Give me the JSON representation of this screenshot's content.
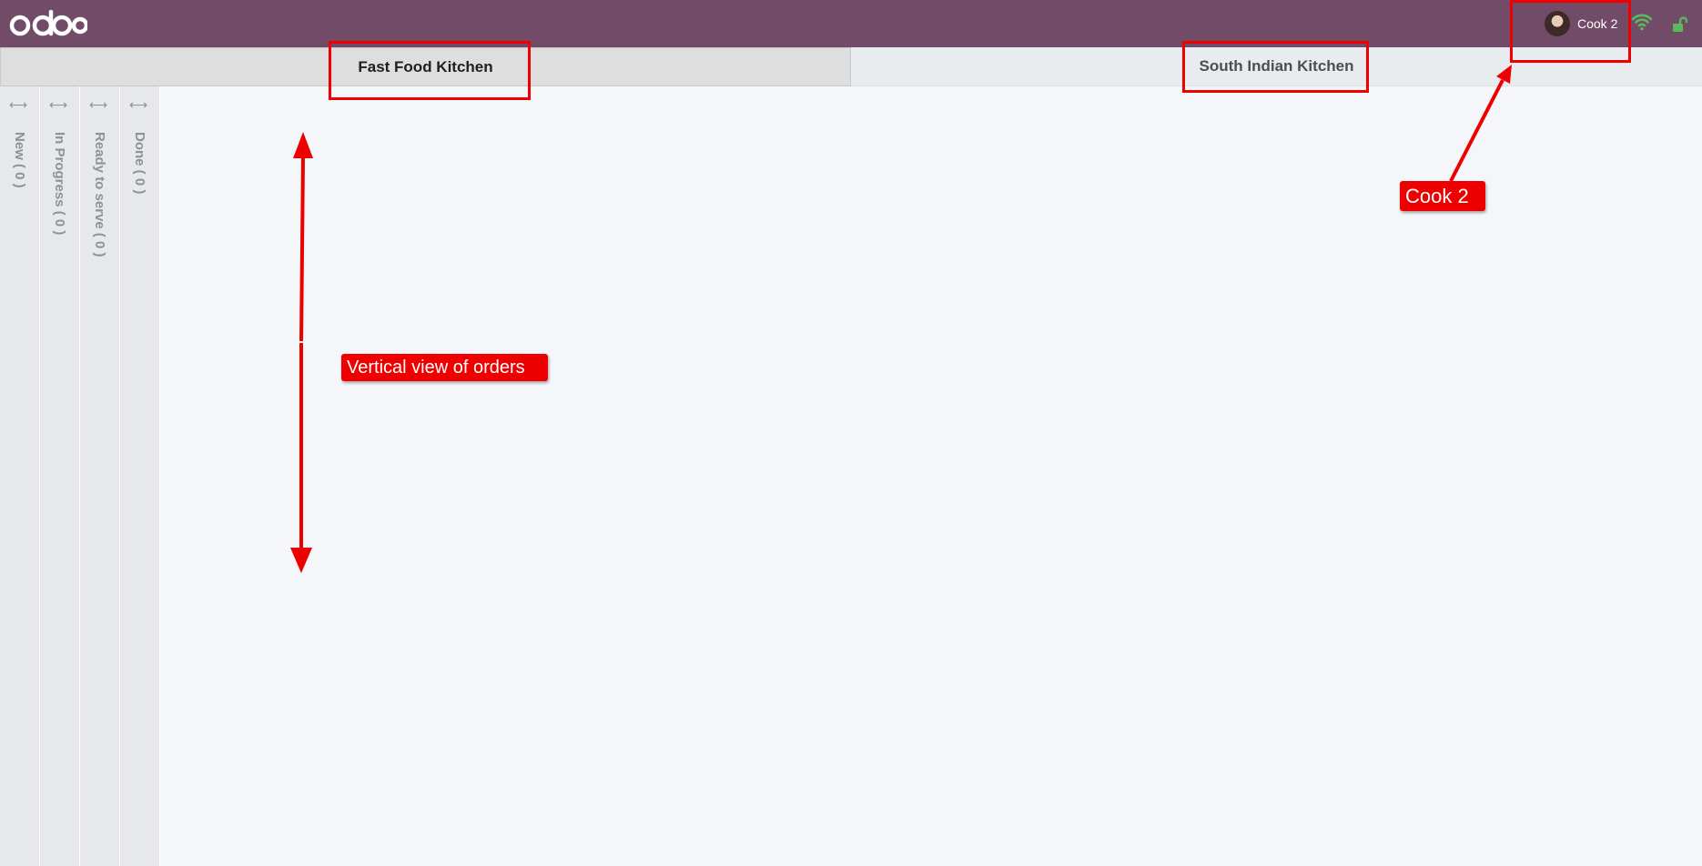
{
  "navbar": {
    "logo_text": "odoo",
    "user_name": "Cook 2",
    "wifi_icon": "wifi-icon",
    "lock_icon": "unlock-icon",
    "status_color": "#5cb85c",
    "bar_color": "#714b67"
  },
  "tabs": [
    {
      "label": "Fast Food Kitchen",
      "active": true
    },
    {
      "label": "South Indian Kitchen",
      "active": false
    }
  ],
  "columns": [
    {
      "label": "New ( 0 )"
    },
    {
      "label": "In Progress ( 0 )"
    },
    {
      "label": "Ready to serve ( 0 )"
    },
    {
      "label": "Done ( 0 )"
    }
  ],
  "annotations": {
    "vertical_label": "Vertical view of orders",
    "cook_label": "Cook 2",
    "color": "#ee0000"
  }
}
